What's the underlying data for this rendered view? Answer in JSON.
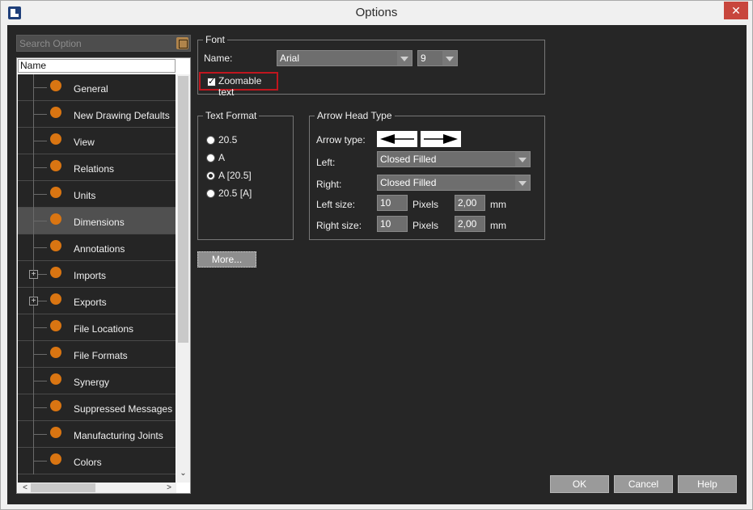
{
  "window": {
    "title": "Options",
    "close_glyph": "✕"
  },
  "search": {
    "placeholder": "Search Option"
  },
  "tree": {
    "header": "Name",
    "items": [
      {
        "label": "General",
        "expandable": false
      },
      {
        "label": "New Drawing Defaults",
        "expandable": false
      },
      {
        "label": "View",
        "expandable": false
      },
      {
        "label": "Relations",
        "expandable": false
      },
      {
        "label": "Units",
        "expandable": false
      },
      {
        "label": "Dimensions",
        "expandable": false,
        "selected": true
      },
      {
        "label": "Annotations",
        "expandable": false
      },
      {
        "label": "Imports",
        "expandable": true
      },
      {
        "label": "Exports",
        "expandable": true
      },
      {
        "label": "File Locations",
        "expandable": false
      },
      {
        "label": "File Formats",
        "expandable": false
      },
      {
        "label": "Synergy",
        "expandable": false
      },
      {
        "label": "Suppressed Messages",
        "expandable": false
      },
      {
        "label": "Manufacturing Joints",
        "expandable": false
      },
      {
        "label": "Colors",
        "expandable": false
      }
    ],
    "expander_glyph": "+",
    "scroll_down": "⌄",
    "scroll_left": "<",
    "scroll_right": ">"
  },
  "font": {
    "legend": "Font",
    "name_label": "Name:",
    "name_value": "Arial",
    "size_value": "9",
    "zoomable_label": "Zoomable text",
    "zoomable_checked": true
  },
  "text_format": {
    "legend": "Text Format",
    "options": [
      {
        "label": "20.5",
        "checked": false
      },
      {
        "label": "A",
        "checked": false
      },
      {
        "label": "A [20.5]",
        "checked": true
      },
      {
        "label": "20.5 [A]",
        "checked": false
      }
    ]
  },
  "arrow_head": {
    "legend": "Arrow Head Type",
    "arrow_type_label": "Arrow type:",
    "left_label": "Left:",
    "left_value": "Closed Filled",
    "right_label": "Right:",
    "right_value": "Closed Filled",
    "left_size_label": "Left size:",
    "left_size_pixels": "10",
    "left_size_mm": "2,00",
    "right_size_label": "Right size:",
    "right_size_pixels": "10",
    "right_size_mm": "2,00",
    "pixels_unit": "Pixels",
    "mm_unit": "mm"
  },
  "buttons": {
    "more": "More...",
    "ok": "OK",
    "cancel": "Cancel",
    "help": "Help"
  },
  "colors": {
    "accent_dot": "#d97512",
    "highlight_border": "#c0161e"
  }
}
